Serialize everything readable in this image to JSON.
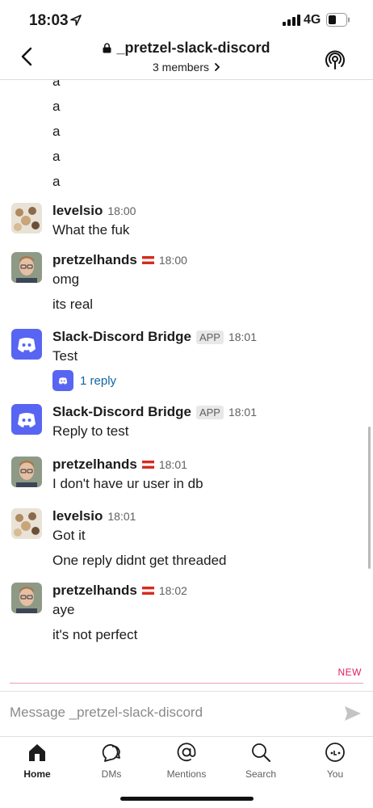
{
  "status_bar": {
    "time": "18:03",
    "network": "4G"
  },
  "header": {
    "channel": "_pretzel-slack-discord",
    "members": "3 members"
  },
  "earlier_lines": [
    "a",
    "a",
    "a",
    "a",
    "a"
  ],
  "messages": [
    {
      "author": "levelsio",
      "time": "18:00",
      "lines": [
        "What the fuk"
      ]
    },
    {
      "author": "pretzelhands",
      "time": "18:00",
      "lines": [
        "omg",
        "its real"
      ]
    },
    {
      "author": "Slack-Discord Bridge",
      "badge": "APP",
      "time": "18:01",
      "lines": [
        "Test"
      ],
      "thread_reply": "1 reply"
    },
    {
      "author": "Slack-Discord Bridge",
      "badge": "APP",
      "time": "18:01",
      "lines": [
        "Reply to test"
      ]
    },
    {
      "author": "pretzelhands",
      "time": "18:01",
      "lines": [
        "I don't have ur user in db"
      ]
    },
    {
      "author": "levelsio",
      "time": "18:01",
      "lines": [
        "Got it",
        "One reply didnt get threaded"
      ]
    },
    {
      "author": "pretzelhands",
      "time": "18:02",
      "lines": [
        "aye",
        "it's not perfect"
      ]
    }
  ],
  "new_marker": "NEW",
  "composer": {
    "placeholder": "Message _pretzel-slack-discord"
  },
  "tabs": [
    {
      "label": "Home",
      "icon": "home-icon",
      "active": true
    },
    {
      "label": "DMs",
      "icon": "dms-icon"
    },
    {
      "label": "Mentions",
      "icon": "at-icon"
    },
    {
      "label": "Search",
      "icon": "search-icon"
    },
    {
      "label": "You",
      "icon": "profile-icon"
    }
  ],
  "colors": {
    "link": "#1264a3",
    "discord": "#5865f2",
    "new": "#e01e5a",
    "flag_red": "#d52b1e"
  }
}
